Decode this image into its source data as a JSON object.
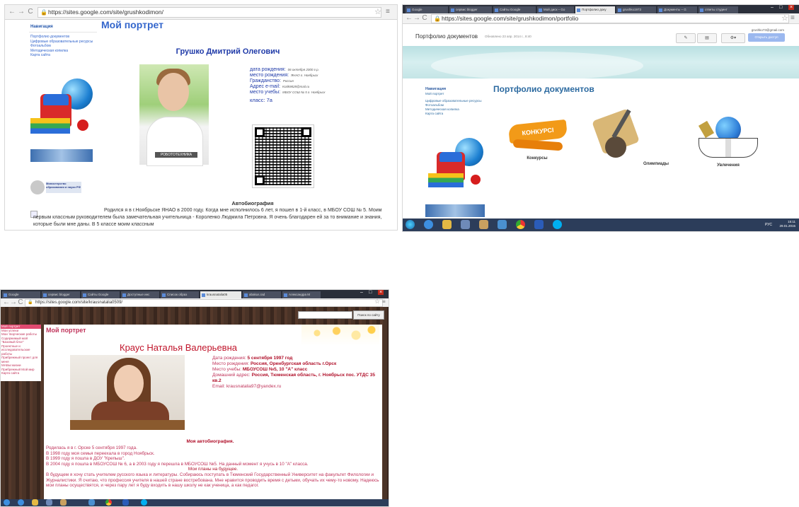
{
  "shot1": {
    "url": "https://sites.google.com/site/grushkodimon/",
    "nav_heading": "Навигация",
    "nav_items": [
      "Портфолио документов",
      "Цифровые образовательные ресурсы",
      "Фотоальбом",
      "Методическая копилка",
      "Карта сайта"
    ],
    "badge_text": "Министерство образования и науки РФ",
    "page_title": "Мой портрет",
    "person_name": "Грушко Дмитрий Олегович",
    "photo_caption": "РОБОТОТЕХНИКА",
    "info": [
      {
        "label": "дата рождения:",
        "value": "06 октября 2000 г.р."
      },
      {
        "label": "место рождения:",
        "value": "ЯНАО г. Ноябрьск"
      },
      {
        "label": "Гражданство:",
        "value": "Россия"
      },
      {
        "label": "Адрес e-mail:",
        "value": "Kotik9828@mail.ru"
      },
      {
        "label": "место учебы:",
        "value": "МБОУ СОШ № 5 г. Ноябрьск"
      }
    ],
    "class_label": "класс: 7а",
    "bio_title": "Автобиография",
    "bio_text": "Родился я в г.Ноябрьске ЯНАО в 2000 году. Когда мне исполнилось 6 лет, я пошел в 1-й класс, в МБОУ СОШ № 5. Моим первым классным руководителем была замечательная учительница - Короленко Людмила Петровна. Я очень благодарен ей за то внимание и знания, которые были мне даны. В 5 классе моим классным"
  },
  "shot2": {
    "tabs": [
      "Google",
      "сервис blogger",
      "Сайты Google",
      "Мой диск – Go",
      "Портфолио доку",
      "grushko1973",
      "Документы – G",
      "ответы студент"
    ],
    "url": "https://sites.google.com/site/grushkodimon/portfolio",
    "site_title": "Портфолио документов",
    "updated": "Обновлено 23 апр. 2014 г., 8:40",
    "user_email": "grushko73@gmail.com",
    "share_label": "Открыть доступ",
    "nav_heading": "Навигация",
    "nav_items": [
      "Мой портрет",
      "Цифровые образовательные ресурсы",
      "Фотоальбом",
      "Методическая копилка",
      "Карта сайта"
    ],
    "page_title": "Портфолио документов",
    "items": [
      {
        "label": "Конкурсы",
        "badge": "КОНКУРСІ"
      },
      {
        "label": "Олимпиады"
      },
      {
        "label": "Увлечения"
      }
    ],
    "lang": "РУС",
    "clock_time": "15:11",
    "clock_date": "29.01.2015"
  },
  "shot3": {
    "tabs": [
      "Google",
      "сервис blogger",
      "Сайты Google",
      "Доступные инс",
      "Список образ",
      "krausnatalia05",
      "abakus.rad",
      "Александра М"
    ],
    "url": "https://sites.google.com/site/krausnatalia0509/",
    "search_button": "Поиск по сайту",
    "nav_items": [
      "Мой портрет",
      "Мои успехи",
      "Мои творческие работы",
      "Содержимый мой \"Базовый блог\"",
      "Проектные и исследовательские работы",
      "Прибрежный проект для меня",
      "МАБЫ жизни",
      "Прибрежный Мой мир",
      "Карта сайта"
    ],
    "page_title": "Мой портрет",
    "person_name": "Краус Наталья Валерьевна",
    "info": [
      {
        "label": "Дата рождения:",
        "value": "5 сентября 1997 год"
      },
      {
        "label": "Место рождения:",
        "value": "Россия, Оренбургская область г.Орск"
      },
      {
        "label": "Место учебы:",
        "value": "МБОУСОШ №5, 10 \"А\" класс"
      },
      {
        "label": "Домашний адрес:",
        "value": "Россия, Тюменская область, г. Ноябрьск пос. УТДС 35 кв.2"
      },
      {
        "label": "Email:",
        "value": "krausnatalia97@yandex.ru"
      }
    ],
    "bio_title": "Моя автобиография.",
    "bio_lines": [
      "Родилась я в г. Орске 5 сентября 1997 года.",
      "В 1998 году моя семья переехала в город Ноябрьск.",
      "В 1999 году я пошла в ДОУ \"Крепыш\".",
      "В 2004 году я пошла в МБОУСОШ № 6, а в 2003 году я перешла в МБОУСОШ №5. На данный момент я учусь в 10 \"А\" класса."
    ],
    "plans_title": "Мои планы на будущее.",
    "plans_text": "В будущем я хочу стать учителем русского языка и литературы. Собираюсь поступать в Тюменский Государственный Университет на факультет Филологии и Журналистики. Я считаю, что профессия учителя в нашей стране востребована. Мне нравится проводить время с детьми, обучать их чему-то новому. Надеюсь мои планы осуществятся, и через пару лет я буду входить в нашу школу не как ученица, а как педагог."
  }
}
